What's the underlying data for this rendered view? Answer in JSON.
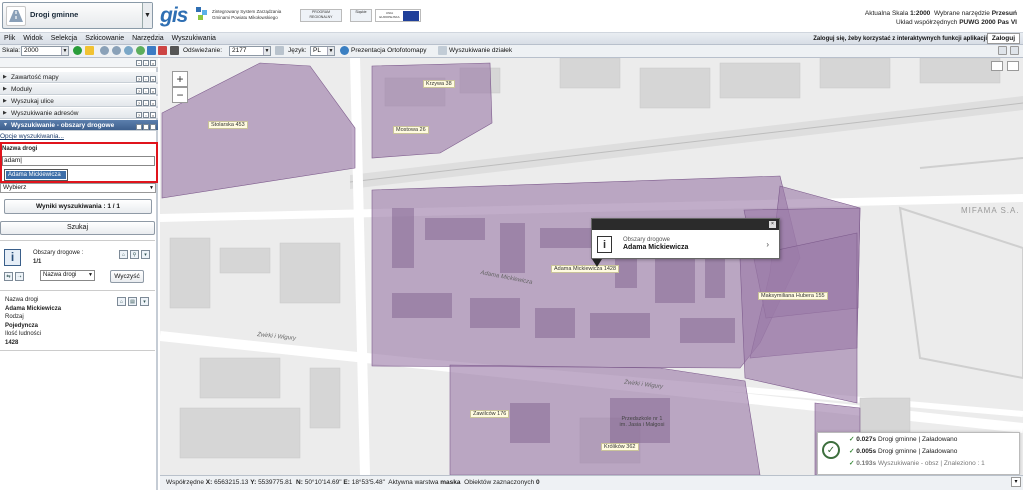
{
  "header": {
    "module_select": "Drogi gminne",
    "brand": "gis",
    "system_name": "Zintegrowany System Zarządzania Gminami Powiatu Mikołowskiego",
    "partner_logos": [
      "PROGRAM REGIONALNY",
      "Śląskie",
      "UNIA EUROPEJSKA"
    ],
    "scale_prefix": "Aktualna Skala",
    "scale_value": "1:2000",
    "tool_prefix": "Wybrane narzędzie",
    "tool_value": "Przesuń",
    "crs_prefix": "Układ współrzędnych",
    "crs_value": "PUWG 2000 Pas VI"
  },
  "menu": [
    "Plik",
    "Widok",
    "Selekcja",
    "Szkicowanie",
    "Narzędzia",
    "Wyszukiwania"
  ],
  "login": {
    "hint": "Zaloguj się, żeby korzystać z interaktywnych funkcji aplikacji",
    "button": "Zaloguj"
  },
  "toolbar": {
    "scale_label": "Skala:",
    "scale_value": "2000",
    "refresh_label": "Odświeżanie:",
    "refresh_value": "2177",
    "lang_label": "Język:",
    "lang_value": "PL",
    "ortho_label": "Prezentacja Ortofotomapy",
    "parcels_label": "Wyszukiwanie działek"
  },
  "sidebar": {
    "panels": [
      "Zawartość mapy",
      "Moduły",
      "Wyszukaj ulice",
      "Wyszukiwanie adresów",
      "Wyszukiwanie - obszary drogowe"
    ],
    "options_link": "Opcje wyszukiwania...",
    "field_label": "Nazwa drogi",
    "field_value": "adam",
    "suggestion": "Adama Mickiewicza",
    "select_value": "Wybierz",
    "results_label": "Wyniki wyszukiwania : 1 / 1",
    "search_button": "Szukaj",
    "layer_name": "Obszary drogowe :",
    "layer_count": "1/1",
    "field_dropdown": "Nazwa drogi",
    "clear_button": "Wyczyść",
    "attrs": [
      {
        "k": "Nazwa drogi",
        "v": "Adama Mickiewicza"
      },
      {
        "k": "Rodzaj",
        "v": "Pojedyncza"
      },
      {
        "k": "Ilość ludności",
        "v": "1428"
      }
    ]
  },
  "map": {
    "labels": {
      "stolarska": "Stolarska 453",
      "krzywa": "Krzywa 38",
      "mostowa": "Mostowa 26",
      "mickiewicza": "Adama Mickiewicza 1428",
      "hubera": "Maksymiliana Hubera 155",
      "zawilcow": "Zawilców 176",
      "krolikow": "Królików 362"
    },
    "streets": {
      "adama": "Adama Mickiewicza",
      "zwirki": "Żwirki i Wigury",
      "zwirki2": "Żwirki i Wigury",
      "mifama": "MIFAMA S.A.",
      "przedszkole": "Przedszkole nr 1 im. Jasia i Małgosi"
    },
    "popup": {
      "layer": "Obszary drogowe",
      "name": "Adama Mickiewicza"
    }
  },
  "status": {
    "coords_label": "Współrzędne",
    "x": "6563215.13",
    "y": "5539775.81",
    "n": "50°10'14.69\"",
    "e": "18°53'5.48\"",
    "layer_label": "Aktywna warstwa",
    "layer_value": "maska",
    "selected_label": "Obiektów zaznaczonych",
    "selected_value": "0"
  },
  "notifications": [
    {
      "time": "0.027s",
      "layer": "Drogi gminne",
      "status": "Załadowano"
    },
    {
      "time": "0.005s",
      "layer": "Drogi gminne",
      "status": "Załadowano"
    },
    {
      "time": "0.193s",
      "layer": "Wyszukiwanie - obsz",
      "status": "Znaleziono : 1"
    }
  ],
  "colors": {
    "accent": "#3d5f8d",
    "highlight": "#e0141c",
    "road_area": "#9b7aa8"
  }
}
